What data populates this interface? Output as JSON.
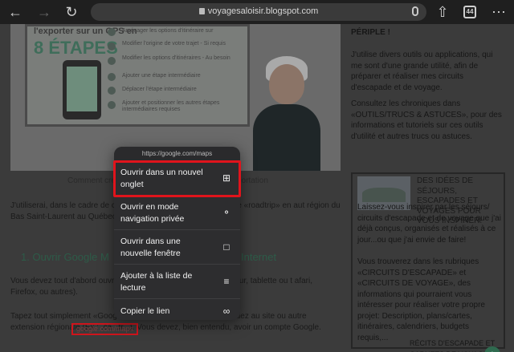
{
  "browser": {
    "url": "voyagesaloisir.blogspot.com",
    "tab_count": "44"
  },
  "article": {
    "hero_line1": "l'exporter sur un GPS en",
    "hero_line2": "8 ÉTAPES",
    "hero_steps": [
      "Aménager les options d'itinéraire sur",
      "Modifier l'origine de votre trajet - Si requis",
      "Modifier les options d'itinéraires - Au besoin",
      "Ajouter une étape intermédiaire",
      "Déplacer l'étape intermédiaire",
      "Ajouter et positionner les autres étapes intermédiaires requises"
    ],
    "caption_left": "Comment cré",
    "caption_right": "portation",
    "para1": "J'utiliserai, dans le cadre de ce                         exemple simple, d'un itinéraire de «roadtrip» en aut                              région du Bas Saint-Laurent au Québec, en partan                               de Québec.",
    "heading_left": "1.  Ouvrir Google M",
    "heading_right": "Internet",
    "para2": "Vous devez tout d'abord ouvr                              ur internet favori sur votre ordinateur, tablette ou t                          afari, Firefox, ou autres).",
    "para3": "Tapez tout simplement «Googl                            votre navigateur internet et accédez au site                        ou autre extension régionale (Ex.: .ca, .fr...). Vous devez, bien entendu, avoir un compte Google.",
    "link_text": "google.com/maps"
  },
  "sidebar": {
    "top_text": "PÉRIPLE !",
    "para1": "J'utilise divers outils ou applications, qui me sont d'une grande utilité, afin de préparer et réaliser mes circuits d'escapade et de voyage.",
    "para2": "Consultez les chroniques dans «OUTILS/TRUCS & ASTUCES», pour des informations et tutoriels sur ces outils d'utilité et autres trucs ou astuces.",
    "box_title": "DES IDÉES DE SÉJOURS, ESCAPADES ET VOYAGES POUR VOUS INSPIRER!",
    "box_para1": "Laissez-vous inspirer par les séjours/ circuits d'escapade et de voyage que j'ai déjà conçus, organisés et réalisés à ce jour...ou que j'ai envie de faire!",
    "box_para2": "Vous trouverez dans les rubriques «CIRCUITS D'ESCAPADE» et «CIRCUITS DE VOYAGE», des informations qui pourraient vous intéresser pour réaliser votre propre projet: Description, plans/cartes, itinéraires, calendriers, budgets requis,...",
    "bottom_title": "RÉCITS D'ESCAPADE ET CARNETS DE VOYAGE"
  },
  "context_menu": {
    "header_url": "https://google.com/maps",
    "items": [
      {
        "label": "Ouvrir dans un nouvel onglet",
        "icon": "plus-square-icon"
      },
      {
        "label": "Ouvrir en mode navigation privée",
        "icon": "incognito-icon"
      },
      {
        "label": "Ouvrir dans une nouvelle fenêtre",
        "icon": "new-window-icon"
      },
      {
        "label": "Ajouter à la liste de lecture",
        "icon": "reading-list-icon"
      },
      {
        "label": "Copier le lien",
        "icon": "link-icon"
      }
    ]
  },
  "colors": {
    "highlight": "#e0141c",
    "menu_bg": "#2d2d2f",
    "heading": "#2d5b48"
  }
}
